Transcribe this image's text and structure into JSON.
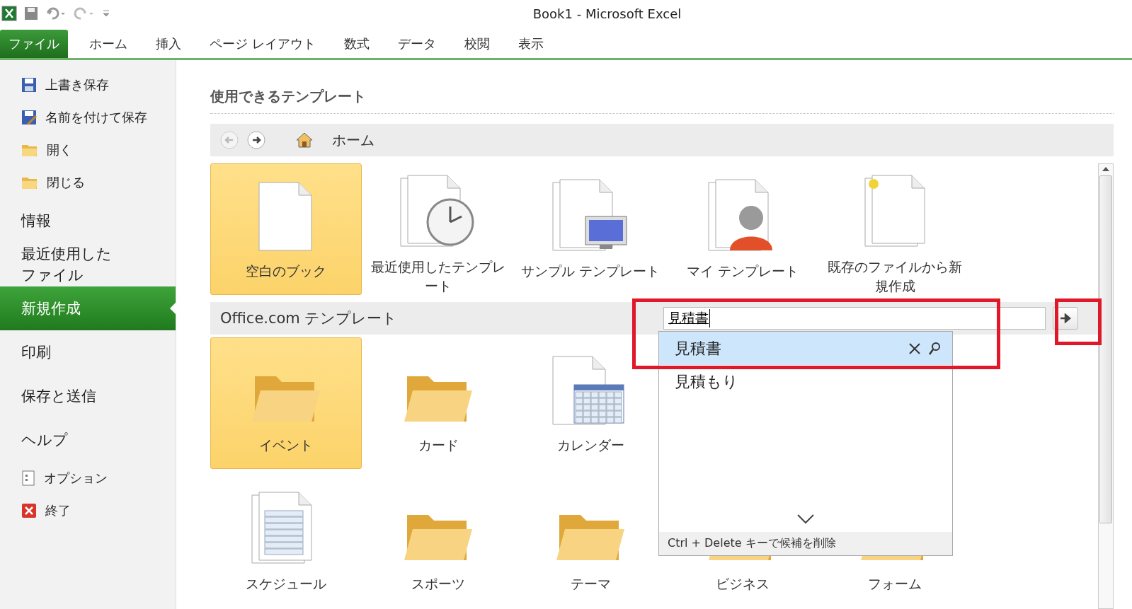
{
  "window": {
    "title": "Book1  -  Microsoft Excel"
  },
  "ribbon_tabs": [
    {
      "label": "ファイル",
      "selected": true
    },
    {
      "label": "ホーム",
      "selected": false
    },
    {
      "label": "挿入",
      "selected": false
    },
    {
      "label": "ページ レイアウト",
      "selected": false
    },
    {
      "label": "数式",
      "selected": false
    },
    {
      "label": "データ",
      "selected": false
    },
    {
      "label": "校閲",
      "selected": false
    },
    {
      "label": "表示",
      "selected": false
    }
  ],
  "sidebar": {
    "items": [
      {
        "label": "上書き保存",
        "kind": "command",
        "selected": false
      },
      {
        "label": "名前を付けて保存",
        "kind": "command",
        "selected": false
      },
      {
        "label": "開く",
        "kind": "command",
        "selected": false
      },
      {
        "label": "閉じる",
        "kind": "command",
        "selected": false
      },
      {
        "label": "情報",
        "kind": "section",
        "selected": false
      },
      {
        "label": "最近使用したファイル",
        "kind": "section",
        "selected": false
      },
      {
        "label": "新規作成",
        "kind": "section",
        "selected": true
      },
      {
        "label": "印刷",
        "kind": "section",
        "selected": false
      },
      {
        "label": "保存と送信",
        "kind": "section",
        "selected": false
      },
      {
        "label": "ヘルプ",
        "kind": "section",
        "selected": false
      },
      {
        "label": "オプション",
        "kind": "command",
        "selected": false
      },
      {
        "label": "終了",
        "kind": "command",
        "selected": false
      }
    ]
  },
  "heading": "使用できるテンプレート",
  "breadcrumb": "ホーム",
  "templates": [
    {
      "label": "空白のブック",
      "kind": "blank",
      "selected": true
    },
    {
      "label": "最近使用したテンプレート",
      "kind": "recent",
      "selected": false
    },
    {
      "label": "サンプル テンプレート",
      "kind": "sample",
      "selected": false
    },
    {
      "label": "マイ テンプレート",
      "kind": "my",
      "selected": false
    },
    {
      "label": "既存のファイルから新規作成",
      "kind": "existing",
      "selected": false
    }
  ],
  "office": {
    "title": "Office.com テンプレート",
    "search_value": "見積書",
    "rows": [
      [
        {
          "label": "イベント",
          "kind": "folder",
          "selected": true
        },
        {
          "label": "カード",
          "kind": "folder",
          "selected": false
        },
        {
          "label": "カレンダー",
          "kind": "calendar",
          "selected": false
        }
      ],
      [
        {
          "label": "スケジュール",
          "kind": "schedule",
          "selected": false
        },
        {
          "label": "スポーツ",
          "kind": "folder",
          "selected": false
        },
        {
          "label": "テーマ",
          "kind": "folder",
          "selected": false
        },
        {
          "label": "ビジネス",
          "kind": "folder",
          "selected": false
        },
        {
          "label": "フォーム",
          "kind": "folder",
          "selected": false
        }
      ]
    ]
  },
  "suggestions": {
    "items": [
      {
        "label": "見積書",
        "selected": true
      },
      {
        "label": "見積もり",
        "selected": false
      }
    ],
    "footer": "Ctrl + Delete キーで候補を削除"
  }
}
